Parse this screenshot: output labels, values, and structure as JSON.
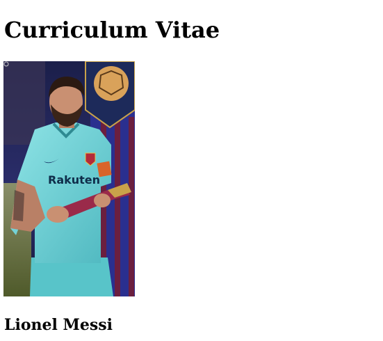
{
  "page": {
    "title": "Curriculum Vitae",
    "name": "Lionel Messi"
  },
  "photo": {
    "alt": "Lionel Messi",
    "shirt_sponsor": "Rakuten",
    "colors": {
      "background_dark": "#1b1f4a",
      "stripe_blue": "#2a2f8f",
      "stripe_red": "#6b1f3f",
      "crest_navy": "#1d2a5a",
      "crest_gold": "#c9a24a",
      "jersey": "#6fd3d6",
      "skin": "#c99072",
      "hair": "#2b1a12",
      "grass": "#6a7a3a"
    }
  }
}
